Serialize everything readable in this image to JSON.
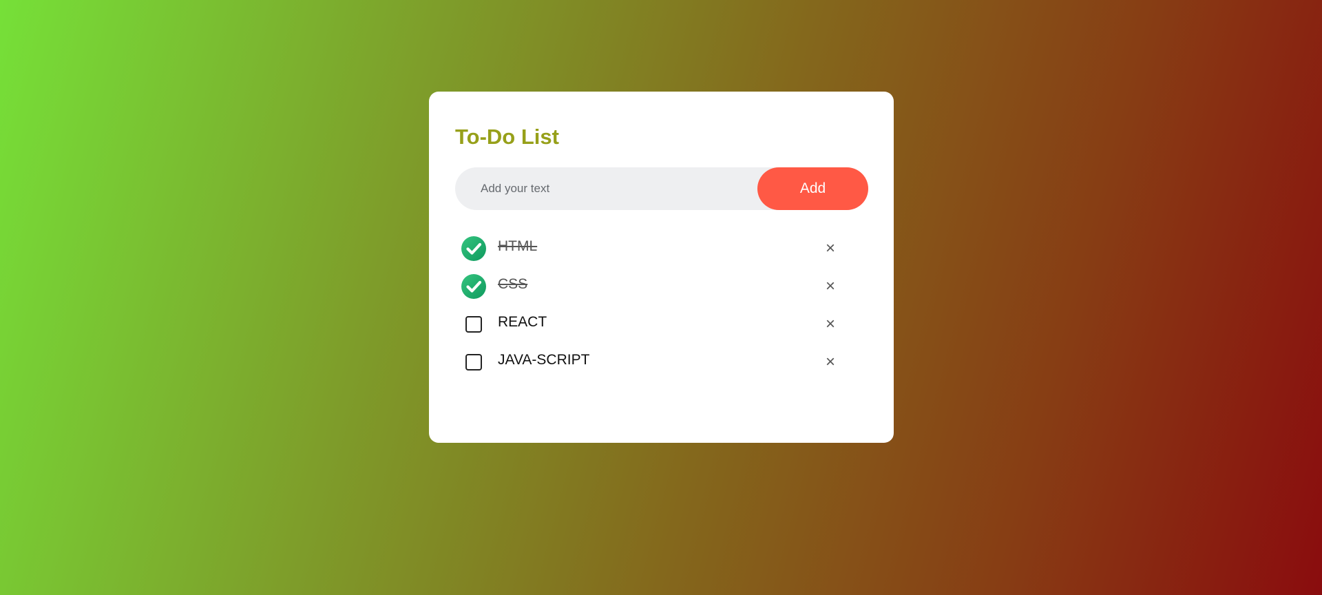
{
  "app": {
    "title": "To-Do List"
  },
  "input": {
    "placeholder": "Add your text",
    "value": ""
  },
  "add_button": {
    "label": "Add"
  },
  "tasks": [
    {
      "text": "HTML",
      "done": true
    },
    {
      "text": "CSS",
      "done": true
    },
    {
      "text": "REACT",
      "done": false
    },
    {
      "text": "JAVA-SCRIPT",
      "done": false
    }
  ],
  "delete_glyph": "×",
  "colors": {
    "title": "#97a01a",
    "accent_button": "#ff5945",
    "check_green": "#1fae6b",
    "input_bg": "#eeeff1",
    "gradient_start": "#76e038",
    "gradient_end": "#8a0c0e"
  },
  "icons": {
    "checked": "checked-circle-icon",
    "unchecked": "unchecked-box-icon",
    "delete": "close-icon"
  }
}
